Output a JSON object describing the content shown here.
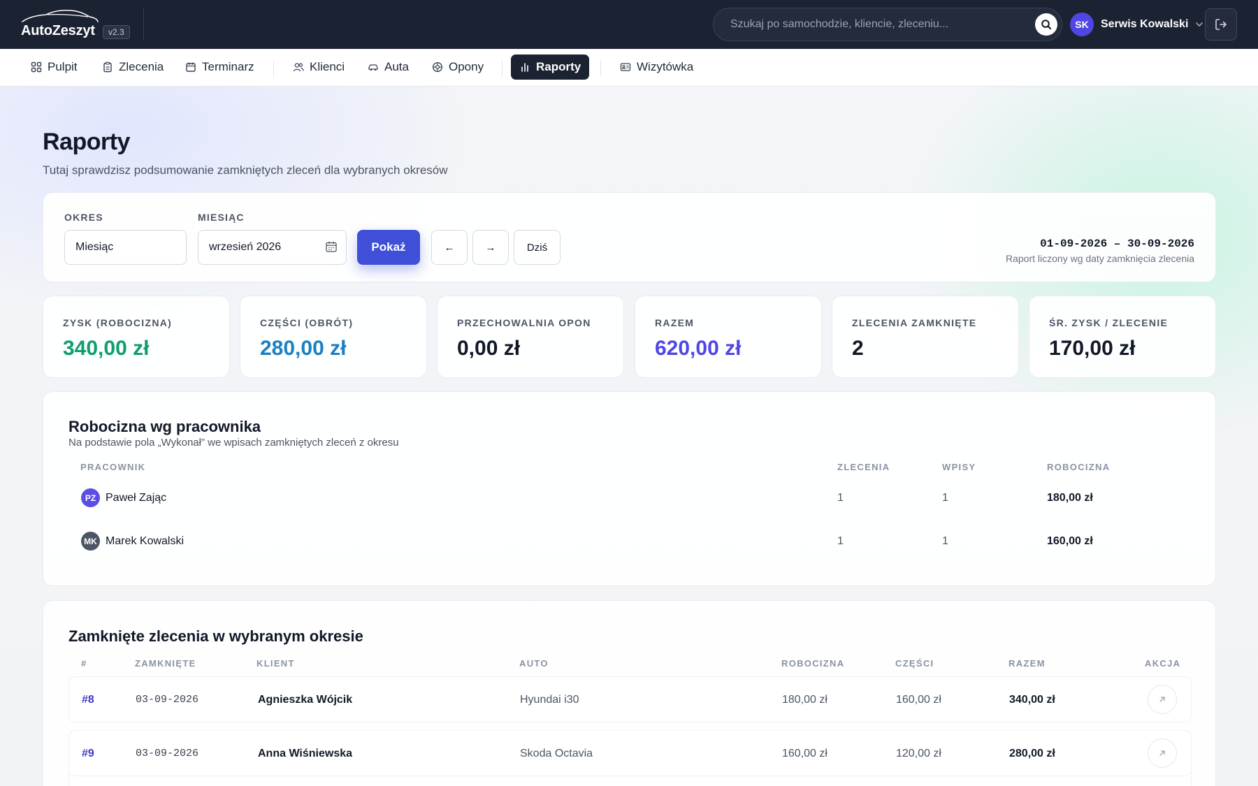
{
  "app": {
    "logo_text": "AutoZeszyt",
    "version": "v2.3"
  },
  "search": {
    "placeholder": "Szukaj po samochodzie, kliencie, zleceniu..."
  },
  "user": {
    "initials": "SK",
    "name": "Serwis Kowalski"
  },
  "nav": {
    "items": [
      {
        "label": "Pulpit",
        "icon": "grid-icon"
      },
      {
        "label": "Zlecenia",
        "icon": "clipboard-icon"
      },
      {
        "label": "Terminarz",
        "icon": "calendar-icon"
      },
      {
        "label": "Klienci",
        "icon": "users-icon"
      },
      {
        "label": "Auta",
        "icon": "car-icon"
      },
      {
        "label": "Opony",
        "icon": "tire-icon"
      },
      {
        "label": "Raporty",
        "icon": "bar-chart-icon",
        "active": true
      },
      {
        "label": "Wizytówka",
        "icon": "id-card-icon"
      }
    ]
  },
  "page": {
    "title": "Raporty",
    "subtitle": "Tutaj sprawdzisz podsumowanie zamkniętych zleceń dla wybranych okresów"
  },
  "filters": {
    "period_label": "Okres",
    "period_value": "Miesiąc",
    "month_label": "Miesiąc",
    "month_value": "wrzesień 2026",
    "show_button": "Pokaż",
    "prev_button": "←",
    "next_button": "→",
    "today_button": "Dziś",
    "date_range": "01-09-2026 – 30-09-2026",
    "range_note": "Raport liczony wg daty zamknięcia zlecenia"
  },
  "stats": [
    {
      "label": "Zysk (robocizna)",
      "value": "340,00 zł",
      "color": "#0e9f6e"
    },
    {
      "label": "Części (obrót)",
      "value": "280,00 zł",
      "color": "#1c7fc4"
    },
    {
      "label": "Przechowalnia opon",
      "value": "0,00 zł",
      "color": "#111827"
    },
    {
      "label": "Razem",
      "value": "620,00 zł",
      "color": "#4f46e5"
    },
    {
      "label": "Zlecenia zamknięte",
      "value": "2",
      "color": "#111827"
    },
    {
      "label": "Śr. zysk / zlecenie",
      "value": "170,00 zł",
      "color": "#111827"
    }
  ],
  "employees": {
    "title": "Robocizna wg pracownika",
    "subtitle": "Na podstawie pola „Wykonał” we wpisach zamkniętych zleceń z okresu",
    "headers": [
      "Pracownik",
      "Zlecenia",
      "Wpisy",
      "Robocizna"
    ],
    "rows": [
      {
        "initials": "PZ",
        "avatar_color": "#5b4ee6",
        "name": "Paweł Zając",
        "orders": "1",
        "entries": "1",
        "labor": "180,00 zł"
      },
      {
        "initials": "MK",
        "avatar_color": "#4b5563",
        "name": "Marek Kowalski",
        "orders": "1",
        "entries": "1",
        "labor": "160,00 zł"
      }
    ]
  },
  "orders": {
    "title": "Zamknięte zlecenia w wybranym okresie",
    "headers": [
      "#",
      "Zamknięte",
      "Klient",
      "Auto",
      "Robocizna",
      "Części",
      "Razem",
      "Akcja"
    ],
    "rows": [
      {
        "id": "#8",
        "closed": "03-09-2026",
        "client": "Agnieszka Wójcik",
        "car": "Hyundai i30",
        "labor": "180,00 zł",
        "parts": "160,00 zł",
        "total": "340,00 zł"
      },
      {
        "id": "#9",
        "closed": "03-09-2026",
        "client": "Anna Wiśniewska",
        "car": "Skoda Octavia",
        "labor": "160,00 zł",
        "parts": "120,00 zł",
        "total": "280,00 zł"
      }
    ]
  }
}
